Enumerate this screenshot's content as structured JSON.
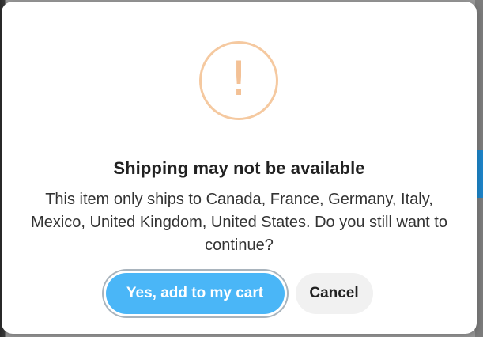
{
  "modal": {
    "icon": "exclamation-icon",
    "icon_glyph": "!",
    "icon_color": "#f3c196",
    "title": "Shipping may not be available",
    "message": "This item only ships to Canada, France, Germany, Italy, Mexico, United Kingdom, United States. Do you still want to continue?",
    "confirm_label": "Yes, add to my cart",
    "cancel_label": "Cancel",
    "confirm_color": "#4ab6f7"
  }
}
